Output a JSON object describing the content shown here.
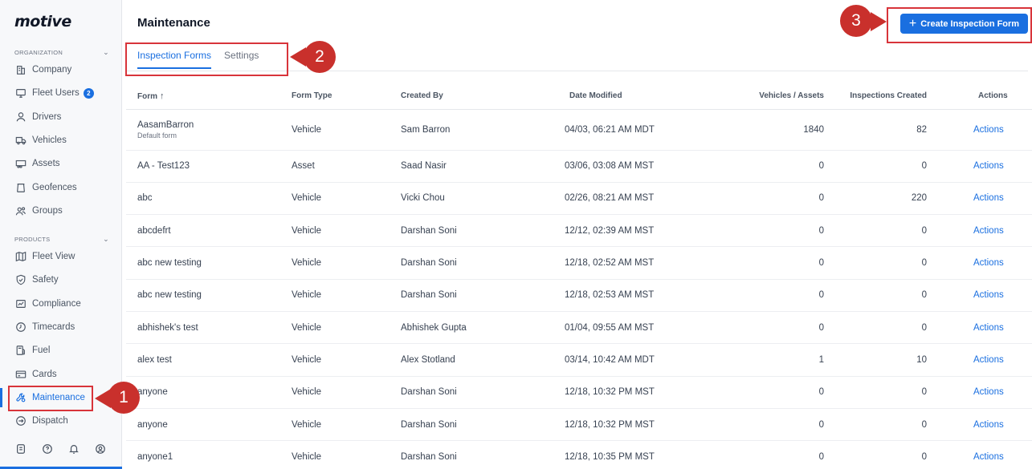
{
  "sidebar": {
    "logo": "motive",
    "organization_label": "ORGANIZATION",
    "products_label": "PRODUCTS",
    "org_items": [
      {
        "label": "Company",
        "icon": "building-icon"
      },
      {
        "label": "Fleet Users",
        "icon": "monitor-icon",
        "badge": "2"
      },
      {
        "label": "Drivers",
        "icon": "person-icon"
      },
      {
        "label": "Vehicles",
        "icon": "truck-icon"
      },
      {
        "label": "Assets",
        "icon": "trailer-icon"
      },
      {
        "label": "Geofences",
        "icon": "geofence-icon"
      },
      {
        "label": "Groups",
        "icon": "group-icon"
      }
    ],
    "product_items": [
      {
        "label": "Fleet View",
        "icon": "map-icon"
      },
      {
        "label": "Safety",
        "icon": "shield-icon"
      },
      {
        "label": "Compliance",
        "icon": "compliance-icon"
      },
      {
        "label": "Timecards",
        "icon": "clock-icon"
      },
      {
        "label": "Fuel",
        "icon": "fuel-icon"
      },
      {
        "label": "Cards",
        "icon": "card-icon"
      },
      {
        "label": "Maintenance",
        "icon": "wrench-icon",
        "active": true
      },
      {
        "label": "Dispatch",
        "icon": "dispatch-icon"
      }
    ]
  },
  "header": {
    "title": "Maintenance",
    "create_button": "Create Inspection Form"
  },
  "tabs": [
    {
      "label": "Inspection Forms",
      "active": true
    },
    {
      "label": "Settings",
      "active": false
    }
  ],
  "table": {
    "columns": [
      "Form",
      "Form Type",
      "Created By",
      "Date Modified",
      "Vehicles / Assets",
      "Inspections Created",
      "Actions"
    ],
    "sort_indicator": "↑",
    "rows": [
      {
        "form": "AasamBarron",
        "sub": "Default form",
        "type": "Vehicle",
        "by": "Sam Barron",
        "date": "04/03, 06:21 AM MDT",
        "vehicles": "1840",
        "inspections": "82",
        "action": "Actions"
      },
      {
        "form": "AA - Test123",
        "type": "Asset",
        "by": "Saad Nasir",
        "date": "03/06, 03:08 AM MST",
        "vehicles": "0",
        "inspections": "0",
        "action": "Actions"
      },
      {
        "form": "abc",
        "type": "Vehicle",
        "by": "Vicki Chou",
        "date": "02/26, 08:21 AM MST",
        "vehicles": "0",
        "inspections": "220",
        "action": "Actions"
      },
      {
        "form": "abcdefrt",
        "type": "Vehicle",
        "by": "Darshan Soni",
        "date": "12/12, 02:39 AM MST",
        "vehicles": "0",
        "inspections": "0",
        "action": "Actions"
      },
      {
        "form": "abc new testing",
        "type": "Vehicle",
        "by": "Darshan Soni",
        "date": "12/18, 02:52 AM MST",
        "vehicles": "0",
        "inspections": "0",
        "action": "Actions"
      },
      {
        "form": "abc new testing",
        "type": "Vehicle",
        "by": "Darshan Soni",
        "date": "12/18, 02:53 AM MST",
        "vehicles": "0",
        "inspections": "0",
        "action": "Actions"
      },
      {
        "form": "abhishek's test",
        "type": "Vehicle",
        "by": "Abhishek Gupta",
        "date": "01/04, 09:55 AM MST",
        "vehicles": "0",
        "inspections": "0",
        "action": "Actions"
      },
      {
        "form": "alex test",
        "type": "Vehicle",
        "by": "Alex Stotland",
        "date": "03/14, 10:42 AM MDT",
        "vehicles": "1",
        "inspections": "10",
        "action": "Actions"
      },
      {
        "form": "anyone",
        "type": "Vehicle",
        "by": "Darshan Soni",
        "date": "12/18, 10:32 PM MST",
        "vehicles": "0",
        "inspections": "0",
        "action": "Actions"
      },
      {
        "form": "anyone",
        "type": "Vehicle",
        "by": "Darshan Soni",
        "date": "12/18, 10:32 PM MST",
        "vehicles": "0",
        "inspections": "0",
        "action": "Actions"
      },
      {
        "form": "anyone1",
        "type": "Vehicle",
        "by": "Darshan Soni",
        "date": "12/18, 10:35 PM MST",
        "vehicles": "0",
        "inspections": "0",
        "action": "Actions"
      }
    ]
  },
  "annotations": {
    "callout_1": "1",
    "callout_2": "2",
    "callout_3": "3",
    "color": "#c9302c"
  },
  "colors": {
    "accent": "#1a6fe0"
  }
}
